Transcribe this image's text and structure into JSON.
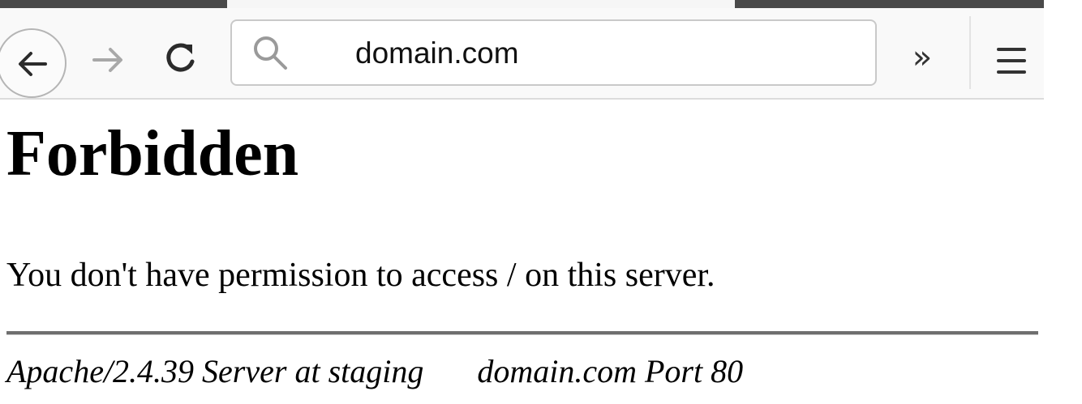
{
  "browser": {
    "address_bar": {
      "value": "domain.com"
    },
    "toolbar": {
      "overflow_label": "»",
      "icons": [
        "back-arrow-icon",
        "forward-arrow-icon",
        "reload-icon",
        "search-icon",
        "hamburger-menu-icon"
      ]
    }
  },
  "page": {
    "title": "Forbidden",
    "message": "You don't have permission to access / on this server.",
    "footer": {
      "server": "Apache/2.4.39 Server at staging",
      "host_port": "domain.com Port 80"
    }
  }
}
